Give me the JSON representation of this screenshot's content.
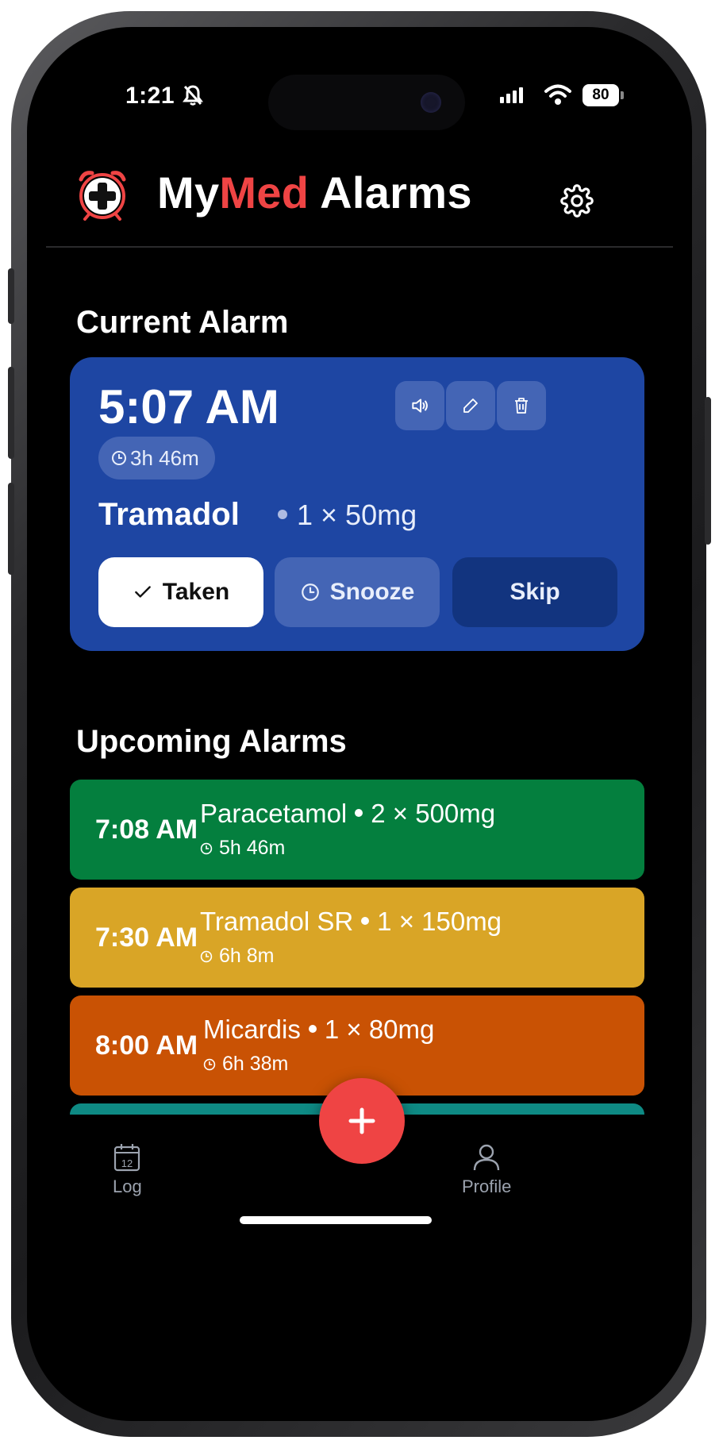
{
  "status_bar": {
    "time": "1:21",
    "battery": "80"
  },
  "header": {
    "title_prefix": "My",
    "title_accent": "Med",
    "title_suffix": " Alarms",
    "accent_color": "#ef4444"
  },
  "current_alarm": {
    "heading": "Current Alarm",
    "time": "5:07 AM",
    "countdown": "3h 46m",
    "medication": "Tramadol",
    "dose": "1 × 50mg",
    "card_color": "#1e46a3",
    "actions": {
      "taken_label": "Taken",
      "snooze_label": "Snooze",
      "skip_label": "Skip"
    },
    "icon_buttons": [
      "speaker-icon",
      "edit-icon",
      "trash-icon"
    ]
  },
  "upcoming": {
    "heading": "Upcoming Alarms",
    "items": [
      {
        "time": "7:08 AM",
        "medication": "Paracetamol",
        "dose": "2 × 500mg",
        "time_left": "5h 46m",
        "color": "#047f3e"
      },
      {
        "time": "7:30 AM",
        "medication": "Tramadol SR",
        "dose": "1 × 150mg",
        "time_left": "6h 8m",
        "color": "#d9a526"
      },
      {
        "time": "8:00 AM",
        "medication": "Micardis",
        "dose": "1 × 80mg",
        "time_left": "6h 38m",
        "color": "#c95204"
      },
      {
        "color": "#0e8a84"
      }
    ]
  },
  "nav": {
    "log_label": "Log",
    "log_icon_day": "12",
    "profile_label": "Profile"
  }
}
